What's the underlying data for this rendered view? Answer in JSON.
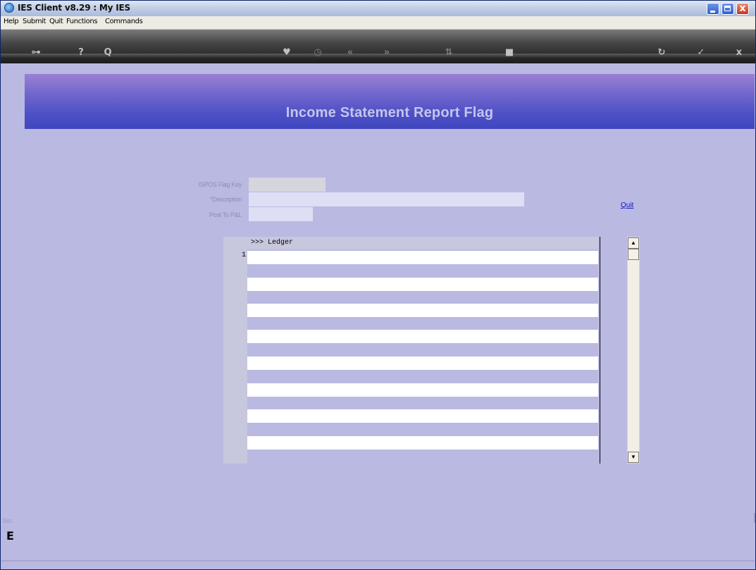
{
  "window": {
    "title": "IES Client v8.29 : My IES",
    "controls": {
      "minimize": "",
      "maximize": "",
      "close": "x"
    }
  },
  "menu": {
    "items": [
      "Help",
      "Submit",
      "Quit",
      "Functions",
      "Commands"
    ]
  },
  "toolbar": {
    "icons": [
      "key-icon",
      "help-icon",
      "search-icon",
      "heart-icon",
      "clock-icon",
      "previous-icon",
      "next-icon",
      "sort-icon",
      "stop-icon",
      "refresh-icon",
      "checkmark-icon",
      "close-icon"
    ],
    "glyphs": {
      "key": "⊶",
      "help": "?",
      "search": "Q",
      "heart": "♥",
      "clock": "◷",
      "prev": "«",
      "next": "»",
      "sort": "⇅",
      "stop": "■",
      "refresh": "↻",
      "check": "✓",
      "close": "x"
    }
  },
  "header": {
    "title": "Income Statement Report Flag"
  },
  "form": {
    "flag_key_label": "ISPOS Flag Key",
    "flag_key_value": "",
    "description_label": "*Description",
    "description_value": "",
    "post_to_pl_label": "Post To P&L",
    "post_to_pl_value": "",
    "quit_link": "Quit"
  },
  "grid": {
    "header": ">>> Ledger",
    "rows": [
      {
        "num": "1",
        "ledger": ""
      }
    ],
    "scroll_up": "▲",
    "scroll_down": "▼"
  },
  "footer": {
    "left_text": "Sec",
    "left_glyph": "E"
  },
  "colors": {
    "background": "#b9b9e2",
    "banner": "#4f52c6",
    "banner_text": "#c5c5ec",
    "link": "#1414c8"
  }
}
